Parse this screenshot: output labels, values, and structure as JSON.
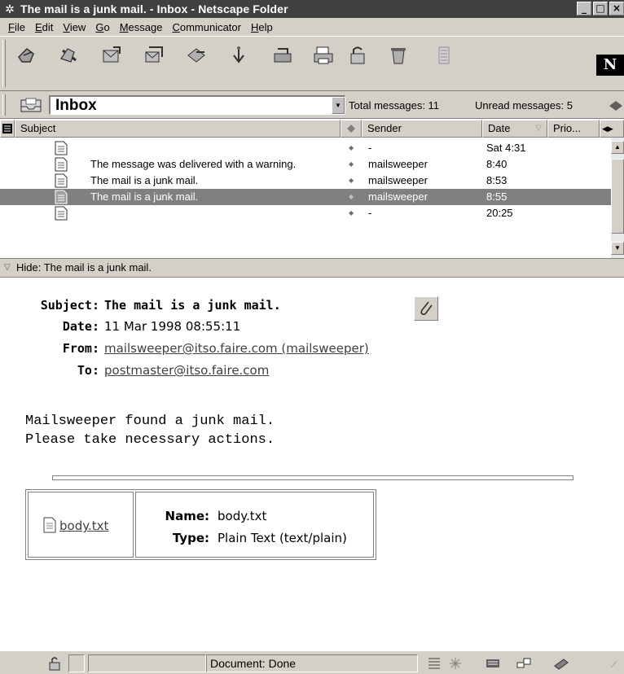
{
  "window": {
    "title": "The mail is a junk mail. - Inbox - Netscape Folder",
    "minimize_label": "_",
    "maximize_label": "□",
    "close_label": "×"
  },
  "menu": {
    "items": [
      {
        "label": "File",
        "mnemonic": "F",
        "rest": "ile"
      },
      {
        "label": "Edit",
        "mnemonic": "E",
        "rest": "dit"
      },
      {
        "label": "View",
        "mnemonic": "V",
        "rest": "iew"
      },
      {
        "label": "Go",
        "mnemonic": "G",
        "rest": "o"
      },
      {
        "label": "Message",
        "mnemonic": "M",
        "rest": "essage"
      },
      {
        "label": "Communicator",
        "mnemonic": "C",
        "rest": "ommunicator"
      },
      {
        "label": "Help",
        "mnemonic": "H",
        "rest": "elp"
      }
    ]
  },
  "toolbar": {
    "buttons": [
      "get-msg",
      "new-msg",
      "reply",
      "reply-all",
      "forward",
      "file",
      "next",
      "print",
      "security",
      "delete",
      "stop"
    ],
    "logo_text": "N"
  },
  "folder_bar": {
    "folder": "Inbox",
    "total_label": "Total messages: 11",
    "unread_label": "Unread messages: 5"
  },
  "message_list": {
    "columns": {
      "subject": "Subject",
      "sender": "Sender",
      "date": "Date",
      "priority": "Prio..."
    },
    "rows": [
      {
        "subject": "",
        "sender": "-",
        "date": "Sat 4:31",
        "selected": false
      },
      {
        "subject": "The message was delivered with a warning.",
        "sender": "mailsweeper",
        "date": "8:40",
        "selected": false
      },
      {
        "subject": "The mail is a junk mail.",
        "sender": "mailsweeper",
        "date": "8:53",
        "selected": false
      },
      {
        "subject": "The mail is a junk mail.",
        "sender": "mailsweeper",
        "date": "8:55",
        "selected": true
      },
      {
        "subject": "",
        "sender": "-",
        "date": "20:25",
        "selected": false
      }
    ]
  },
  "hide_bar": {
    "label": "Hide: The mail is a junk mail."
  },
  "message": {
    "labels": {
      "subject": "Subject:",
      "date": "Date:",
      "from": "From:",
      "to": "To:"
    },
    "subject": "The mail is a junk mail.",
    "date": "11 Mar 1998 08:55:11",
    "from": "mailsweeper@itso.faire.com (mailsweeper)",
    "to": "postmaster@itso.faire.com",
    "body": [
      "Mailsweeper found a junk mail.",
      "Please take necessary actions."
    ],
    "attachment": {
      "link": "body.txt",
      "name_label": "Name:",
      "name": "body.txt",
      "type_label": "Type:",
      "type": "Plain Text (text/plain)"
    }
  },
  "status_bar": {
    "text": "Document: Done"
  }
}
